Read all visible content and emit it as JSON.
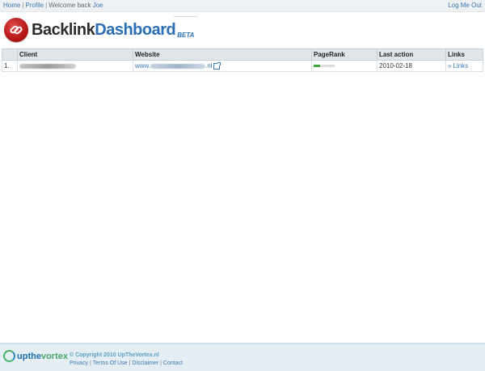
{
  "topbar": {
    "home": "Home",
    "profile": "Profile",
    "welcome": "Welcome back ",
    "user": "Joe",
    "logout": "Log Me Out"
  },
  "brand": {
    "word1": "Backlink",
    "word2": "Dashboard",
    "beta": "BETA"
  },
  "table": {
    "headers": [
      "Client",
      "Website",
      "PageRank",
      "Last action",
      "Links"
    ],
    "rows": [
      {
        "index": "1.",
        "website_prefix": "www.",
        "website_suffix": ".nl",
        "pagerank": 0.3,
        "last_action": "2010-02-18",
        "links_label": "Links"
      }
    ]
  },
  "footer": {
    "brand_part1": "upthe",
    "brand_part2": "vortex",
    "copyright": "© Copyright 2010 UpTheVortex.nl",
    "links": [
      "Privacy",
      "Terms Of Use",
      "Disclaimer",
      "Contact"
    ]
  },
  "colors": {
    "accent": "#3b78b5",
    "logo_red": "#b51717",
    "pagerank_green": "#3fa63f"
  }
}
